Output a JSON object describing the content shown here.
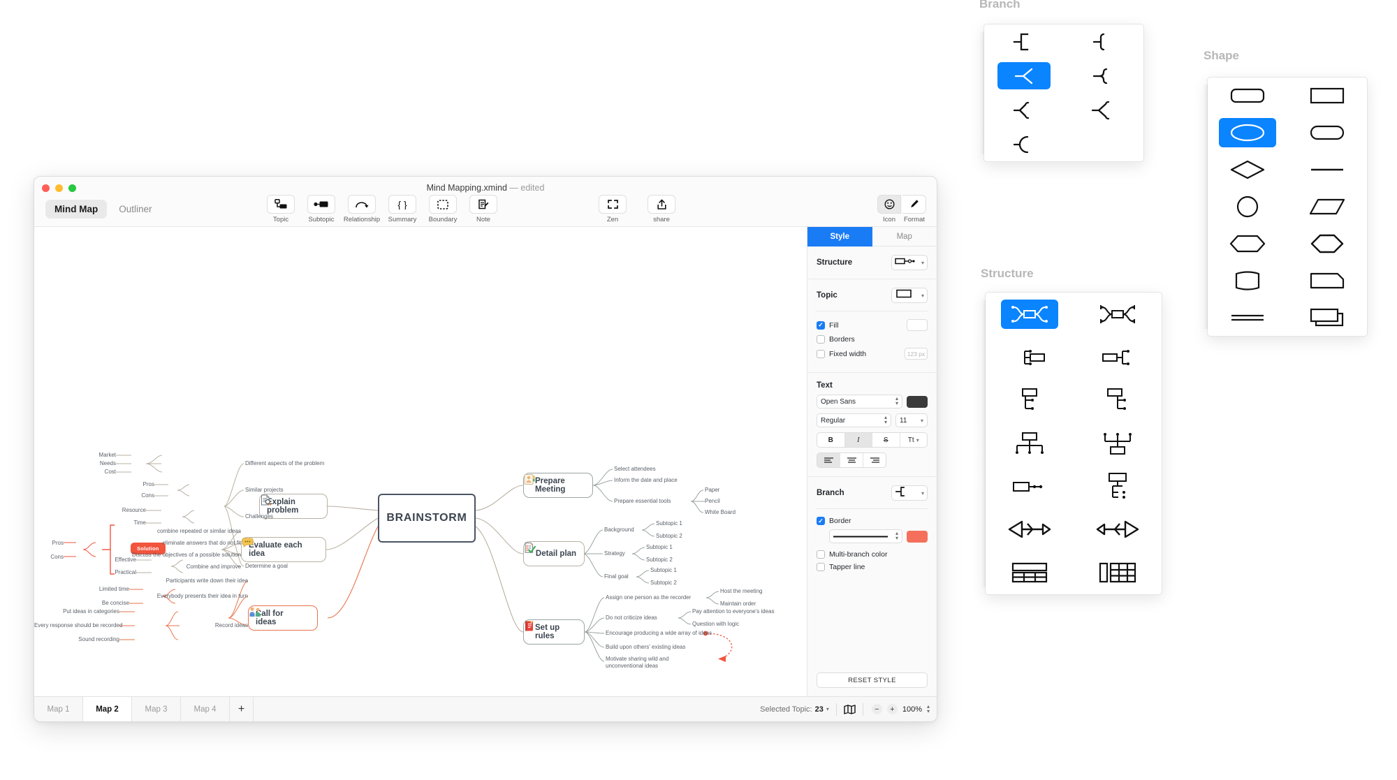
{
  "window": {
    "document_title": "Mind Mapping.xmind",
    "document_state": "— edited",
    "view_tabs": [
      {
        "label": "Mind Map",
        "active": true
      },
      {
        "label": "Outliner",
        "active": false
      }
    ],
    "toolbar": [
      {
        "label": "Topic",
        "icon": "topic-icon"
      },
      {
        "label": "Subtopic",
        "icon": "subtopic-icon"
      },
      {
        "label": "Relationship",
        "icon": "relationship-icon"
      },
      {
        "label": "Summary",
        "icon": "summary-icon"
      },
      {
        "label": "Boundary",
        "icon": "boundary-icon"
      },
      {
        "label": "Note",
        "icon": "note-icon"
      }
    ],
    "toolbar_right": [
      {
        "label": "Zen",
        "icon": "zen-icon"
      },
      {
        "label": "share",
        "icon": "share-icon"
      }
    ],
    "inspector_toggles": [
      {
        "label": "Icon",
        "icon": "smiley-icon",
        "active": true
      },
      {
        "label": "Format",
        "icon": "brush-icon",
        "active": false
      }
    ]
  },
  "inspector": {
    "tabs": [
      {
        "label": "Style",
        "active": true
      },
      {
        "label": "Map",
        "active": false
      }
    ],
    "structure": {
      "title": "Structure",
      "value_icon": "structure-org-right-icon"
    },
    "topic": {
      "title": "Topic",
      "value_icon": "shape-rectangle-icon",
      "fill": {
        "label": "Fill",
        "checked": true,
        "color": "#ffffff"
      },
      "borders": {
        "label": "Borders",
        "checked": false
      },
      "fixed_width": {
        "label": "Fixed width",
        "checked": false,
        "placeholder": "123 px"
      }
    },
    "text": {
      "title": "Text",
      "font_family": "Open Sans",
      "font_color": "#3a3a3a",
      "font_weight": "Regular",
      "font_size": "11",
      "style_buttons": [
        {
          "label": "B",
          "name": "bold",
          "active": false
        },
        {
          "label": "I",
          "name": "italic",
          "active": true
        },
        {
          "label": "S",
          "name": "strikethrough",
          "active": false
        },
        {
          "label": "Tt",
          "name": "text-case",
          "active": false
        }
      ],
      "align_buttons": [
        {
          "name": "align-left",
          "active": true
        },
        {
          "name": "align-center",
          "active": false
        },
        {
          "name": "align-right",
          "active": false
        }
      ]
    },
    "branch": {
      "title": "Branch",
      "value_icon": "branch-elbow-icon",
      "border": {
        "label": "Border",
        "checked": true,
        "color": "#f4705c"
      },
      "multi_branch_color": {
        "label": "Multi-branch color",
        "checked": false
      },
      "tapper_line": {
        "label": "Tapper line",
        "checked": false
      }
    },
    "reset_label": "RESET STYLE"
  },
  "statusbar": {
    "map_tabs": [
      {
        "label": "Map 1",
        "active": false
      },
      {
        "label": "Map 2",
        "active": true
      },
      {
        "label": "Map 3",
        "active": false
      },
      {
        "label": "Map 4",
        "active": false
      }
    ],
    "add_tab_label": "+",
    "selected_topic_label": "Selected Topic:",
    "selected_topic_count": "23",
    "zoom_level": "100%",
    "zoom_out_label": "−",
    "zoom_in_label": "+"
  },
  "popovers": {
    "branch": {
      "title": "Branch",
      "items": [
        {
          "name": "branch-square-bracket",
          "selected": false
        },
        {
          "name": "branch-round-bracket",
          "selected": false
        },
        {
          "name": "branch-arrow-fork",
          "selected": true
        },
        {
          "name": "branch-curve-fork",
          "selected": false
        },
        {
          "name": "branch-angle-fork",
          "selected": false
        },
        {
          "name": "branch-wide-fork",
          "selected": false
        },
        {
          "name": "branch-arc",
          "selected": false
        }
      ]
    },
    "structure": {
      "title": "Structure",
      "items": [
        {
          "name": "structure-balanced-map",
          "selected": true
        },
        {
          "name": "structure-balanced-map-alt",
          "selected": false
        },
        {
          "name": "structure-logic-left",
          "selected": false
        },
        {
          "name": "structure-logic-right",
          "selected": false
        },
        {
          "name": "structure-tree-left",
          "selected": false
        },
        {
          "name": "structure-tree-right",
          "selected": false
        },
        {
          "name": "structure-org-down",
          "selected": false
        },
        {
          "name": "structure-org-up",
          "selected": false
        },
        {
          "name": "structure-timeline-right",
          "selected": false
        },
        {
          "name": "structure-tree-table",
          "selected": false
        },
        {
          "name": "structure-fishbone-left",
          "selected": false
        },
        {
          "name": "structure-fishbone-right",
          "selected": false
        },
        {
          "name": "structure-matrix",
          "selected": false
        },
        {
          "name": "structure-spreadsheet",
          "selected": false
        }
      ]
    },
    "shape": {
      "title": "Shape",
      "items": [
        {
          "name": "shape-rounded-rect",
          "selected": false
        },
        {
          "name": "shape-rect",
          "selected": false
        },
        {
          "name": "shape-ellipse",
          "selected": true
        },
        {
          "name": "shape-stadium",
          "selected": false
        },
        {
          "name": "shape-diamond",
          "selected": false
        },
        {
          "name": "shape-line",
          "selected": false
        },
        {
          "name": "shape-circle",
          "selected": false
        },
        {
          "name": "shape-parallelogram",
          "selected": false
        },
        {
          "name": "shape-hexagon-flat",
          "selected": false
        },
        {
          "name": "shape-hexagon-tall",
          "selected": false
        },
        {
          "name": "shape-barrel",
          "selected": false
        },
        {
          "name": "shape-cut-corner",
          "selected": false
        },
        {
          "name": "shape-double-line",
          "selected": false
        },
        {
          "name": "shape-stacked-rect",
          "selected": false
        }
      ]
    }
  },
  "mindmap": {
    "central": "BRAINSTORM",
    "left_branches": [
      {
        "title": "Explain problem",
        "icon": "document-search-icon",
        "children": [
          {
            "text": "Different aspects of the problem",
            "children": [
              "Market",
              "Needs",
              "Cost"
            ]
          },
          {
            "text": "Similar projects",
            "children": [
              "Pros",
              "Cons"
            ]
          },
          {
            "text": "Challenges",
            "children": [
              "Resource",
              "Time"
            ]
          },
          {
            "text": "Determine a goal",
            "children": [
              "Effective",
              "Practical"
            ]
          }
        ]
      },
      {
        "title": "Evaluate each idea",
        "icon": "speech-bubble-icon",
        "boundary_tag": "Solution",
        "boundary_children": [
          "Pros",
          "Cons"
        ],
        "children": [
          {
            "text": "combine repeated or similar ideas",
            "children": []
          },
          {
            "text": "eliminate answers that do not fit",
            "children": []
          },
          {
            "text": "Discuss the objectives of a possible solution",
            "children": []
          },
          {
            "text": "Combine and improve",
            "children": []
          }
        ]
      },
      {
        "title": "Call for ideas",
        "icon": "people-icon",
        "children": [
          {
            "text": "Participants write down their idea",
            "children": []
          },
          {
            "text": "Everybody presents their idea in turn",
            "children": [
              "Limited time",
              "Be concise"
            ]
          },
          {
            "text": "Record ideas",
            "children": [
              "Put ideas in categories",
              "Every response should be recorded",
              "Sound recording"
            ]
          }
        ]
      }
    ],
    "right_branches": [
      {
        "title": "Prepare Meeting",
        "icon": "contact-card-icon",
        "children": [
          {
            "text": "Select attendees",
            "children": []
          },
          {
            "text": "Inform the date and place",
            "children": []
          },
          {
            "text": "Prepare essential tools",
            "children": [
              "Paper",
              "Pencil",
              "White Board"
            ]
          }
        ]
      },
      {
        "title": "Detail plan",
        "icon": "checklist-icon",
        "children": [
          {
            "text": "Background",
            "children": [
              "Subtopic 1",
              "Subtopic 2"
            ]
          },
          {
            "text": "Strategy",
            "children": [
              "Subtopic 1",
              "Subtopic 2"
            ]
          },
          {
            "text": "Final goal",
            "children": [
              "Subtopic 1",
              "Subtopic 2"
            ]
          }
        ]
      },
      {
        "title": "Set up rules",
        "icon": "red-book-icon",
        "children": [
          {
            "text": "Assign one person as the recorder",
            "children": [
              "Host the meeting",
              "Maintain order"
            ]
          },
          {
            "text": "Do not criticize ideas",
            "children": [
              "Pay attention to everyone's ideas",
              "Question with logic"
            ]
          },
          {
            "text": "Encourage producing a wide array of ideas",
            "children": []
          },
          {
            "text": "Build upon others' existing ideas",
            "children": []
          },
          {
            "text": "Motivate sharing wild and unconventional ideas",
            "children": []
          }
        ]
      }
    ]
  }
}
